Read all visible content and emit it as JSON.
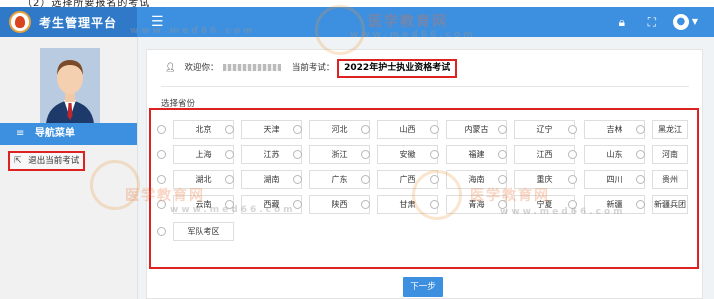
{
  "top_strip": {
    "text": "（2）选择所要报名的考试"
  },
  "header": {
    "brand_title": "考生管理平台",
    "icons": [
      "lock-icon",
      "fullscreen-icon",
      "user-icon"
    ]
  },
  "sidebar": {
    "nav_title": "导航菜单",
    "exit_label": "退出当前考试"
  },
  "main": {
    "welcome_prefix": "欢迎你：",
    "current_exam_label": "当前考试：",
    "current_exam_value": "2022年护士执业资格考试",
    "province_label": "选择省份",
    "provinces": [
      "北京",
      "天津",
      "河北",
      "山西",
      "内蒙古",
      "辽宁",
      "吉林",
      "黑龙江",
      "上海",
      "江苏",
      "浙江",
      "安徽",
      "福建",
      "江西",
      "山东",
      "河南",
      "湖北",
      "湖南",
      "广东",
      "广西",
      "海南",
      "重庆",
      "四川",
      "贵州",
      "云南",
      "西藏",
      "陕西",
      "甘肃",
      "青海",
      "宁夏",
      "新疆",
      "新疆兵团",
      "军队考区"
    ],
    "next_button": "下一步"
  },
  "watermarks": {
    "brand_cn": "医学教育网",
    "url": "www.med66.com"
  },
  "colors": {
    "header_blue": "#3d8fe0",
    "brand_blue": "#2f79c8",
    "highlight_red": "#dd2222"
  }
}
